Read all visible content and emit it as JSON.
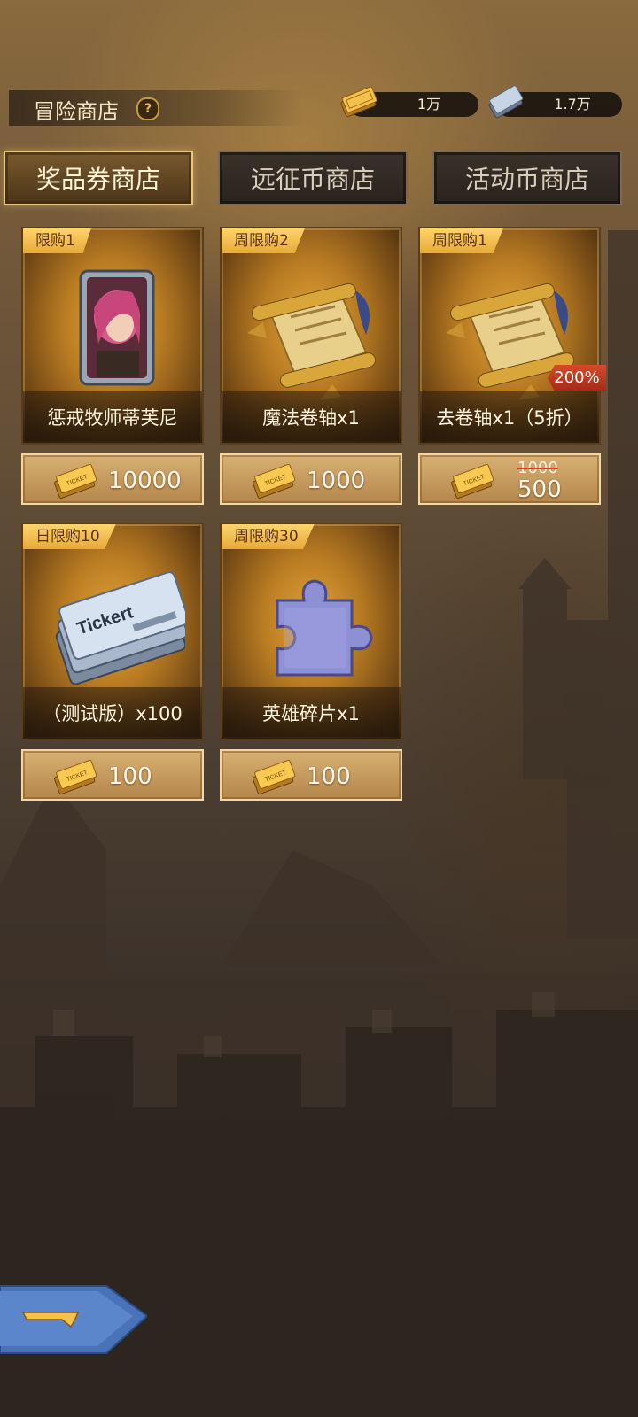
{
  "header": {
    "title": "冒险商店",
    "help_icon": "question-badge-icon",
    "currencies": [
      {
        "icon": "gold-ticket-icon",
        "value": "1万"
      },
      {
        "icon": "silver-ticket-icon",
        "value": "1.7万"
      }
    ]
  },
  "tabs": [
    {
      "label": "奖品券商店",
      "active": true
    },
    {
      "label": "远征币商店",
      "active": false
    },
    {
      "label": "活动币商店",
      "active": false
    }
  ],
  "items": [
    {
      "limit": "限购1",
      "name": "惩戒牧师蒂芙尼",
      "icon": "hero-card-icon",
      "price": "10000"
    },
    {
      "limit": "周限购2",
      "name": "魔法卷轴x1",
      "icon": "magic-scroll-icon",
      "price": "1000"
    },
    {
      "limit": "周限购1",
      "name": "去卷轴x1（5折）",
      "icon": "magic-scroll-icon",
      "badge": "200%",
      "old_price": "1000",
      "price": "500"
    },
    {
      "limit": "日限购10",
      "name": "（测试版）x100",
      "icon": "silver-ticket-icon",
      "ticket_text": "Tickert",
      "price": "100"
    },
    {
      "limit": "周限购30",
      "name": "英雄碎片x1",
      "icon": "puzzle-piece-icon",
      "price": "100"
    }
  ],
  "price_icon": "gold-ticket-icon",
  "ticket_icon_text": "TICKET",
  "back_icon": "back-arrow-icon",
  "colors": {
    "gold": "#e7a93a",
    "tab_active_border": "#e8c77a",
    "sale_badge": "#d64a2a"
  }
}
